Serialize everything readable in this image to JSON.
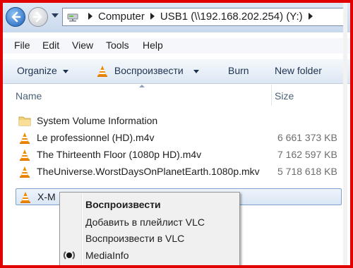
{
  "address": {
    "crumbs": [
      "Computer",
      "USB1 (\\\\192.168.202.254) (Y:)"
    ]
  },
  "menu": [
    "File",
    "Edit",
    "View",
    "Tools",
    "Help"
  ],
  "toolbar": {
    "organize": "Organize",
    "play": "Воспроизвести",
    "burn": "Burn",
    "new_folder": "New folder"
  },
  "columns": {
    "name": "Name",
    "size": "Size"
  },
  "files": [
    {
      "name": "System Volume Information",
      "size": "",
      "type": "folder"
    },
    {
      "name": "Le professionnel (HD).m4v",
      "size": "6 661 373 KB",
      "type": "vlc"
    },
    {
      "name": "The Thirteenth Floor (1080p HD).m4v",
      "size": "7 162 597 KB",
      "type": "vlc"
    },
    {
      "name": "TheUniverse.WorstDaysOnPlanetEarth.1080p.mkv",
      "size": "5 718 618 KB",
      "type": "vlc"
    },
    {
      "name": "X-M",
      "size": "",
      "type": "vlc",
      "selected": true
    }
  ],
  "context_menu": [
    {
      "label": "Воспроизвести",
      "default": true
    },
    {
      "label": "Добавить в плейлист VLC"
    },
    {
      "label": "Воспроизвести в VLC"
    },
    {
      "label": "MediaInfo",
      "icon": "mediainfo-icon"
    }
  ],
  "colors": {
    "frame_border": "#e00000",
    "vlc_orange": "#f08a00",
    "selection": "#d9e6f4"
  }
}
